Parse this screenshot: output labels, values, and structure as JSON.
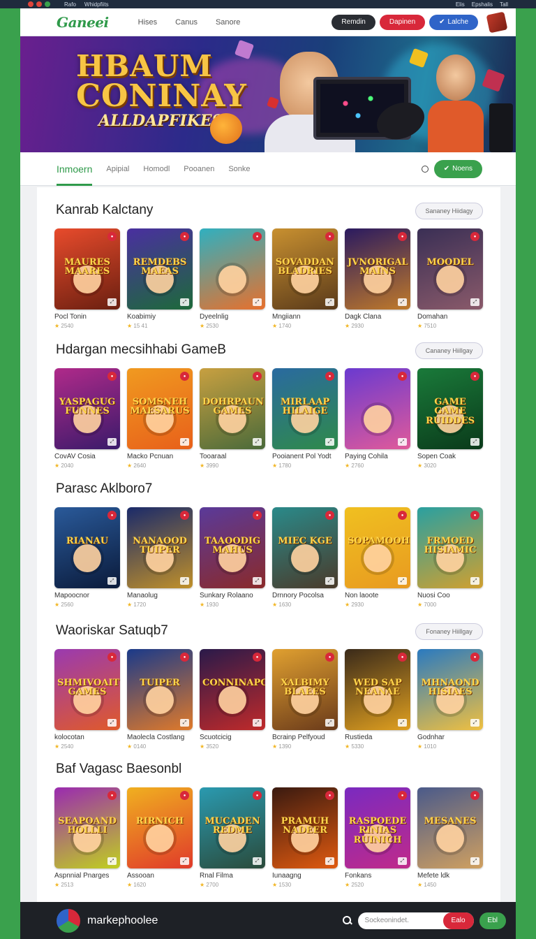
{
  "topbar": {
    "left": "Rafo",
    "left2": "Whidpfiits",
    "right": [
      "Elis",
      "Epshalis",
      "Tall"
    ]
  },
  "nav": {
    "logo": "Ganeei",
    "links": [
      "Hises",
      "Canus",
      "Sanore"
    ],
    "pills": [
      "Remdin",
      "Dapinen",
      "Lalche"
    ]
  },
  "hero": {
    "title_line1": "HBAUM",
    "title_line2": "CONINAY",
    "subtitle": "ALLDAPFIKES"
  },
  "tabs": {
    "items": [
      "Inmoern",
      "Apipial",
      "Homodl",
      "Pooanen",
      "Sonke"
    ],
    "active_index": 0,
    "action": "Noens"
  },
  "sections": [
    {
      "title": "Kanrab Kalctany",
      "button": "Sananey Hiidagy",
      "games": [
        {
          "name": "Pocl Tonin",
          "rating": "2540",
          "art": "MAURES MAARES",
          "colors": [
            "#e84b2c",
            "#6a1f10"
          ]
        },
        {
          "name": "Koabimiy",
          "rating": "15 41",
          "art": "REMDEBS MAEAS",
          "colors": [
            "#4a2fa0",
            "#1d6a3a"
          ]
        },
        {
          "name": "Dyeelnlig",
          "rating": "2530",
          "art": "",
          "colors": [
            "#2fb0c0",
            "#e8702c"
          ]
        },
        {
          "name": "Mngiiann",
          "rating": "1740",
          "art": "SOVADDAN BLADRIES",
          "colors": [
            "#c89030",
            "#5a3a1a"
          ]
        },
        {
          "name": "Dagk Clana",
          "rating": "2930",
          "art": "JVNORIGAL MAINS",
          "colors": [
            "#2a1a60",
            "#c07a2a"
          ]
        },
        {
          "name": "Domahan",
          "rating": "7510",
          "art": "MOODEL",
          "colors": [
            "#3a2f55",
            "#8a5a6a"
          ]
        }
      ]
    },
    {
      "title": "Hdargan mecsihhabi GameB",
      "button": "Cananey Hiillgay",
      "games": [
        {
          "name": "CovAV Cosia",
          "rating": "2040",
          "art": "YASPAGUG FUNNES",
          "colors": [
            "#b02a8a",
            "#3a1a6a"
          ]
        },
        {
          "name": "Macko Pcnuan",
          "rating": "2640",
          "art": "SOMSNEH MAESARUS",
          "colors": [
            "#f09a20",
            "#e8601a"
          ]
        },
        {
          "name": "Tooaraal",
          "rating": "3990",
          "art": "DOHRPAUN GAMES",
          "colors": [
            "#c8a040",
            "#4a6a3a"
          ]
        },
        {
          "name": "Pooianent Pol Yodt",
          "rating": "1780",
          "art": "MIRLAAP HILAIGE",
          "colors": [
            "#2a6aa0",
            "#2f8a4a"
          ]
        },
        {
          "name": "Paying Cohila",
          "rating": "2760",
          "art": "",
          "colors": [
            "#6a3ad0",
            "#e05a9a"
          ]
        },
        {
          "name": "Sopen Coak",
          "rating": "3020",
          "art": "GAME GAME RUIDDES",
          "colors": [
            "#1a7a3a",
            "#0a3a1a"
          ]
        }
      ]
    },
    {
      "title": "Parasc Aklboro7",
      "button": "",
      "games": [
        {
          "name": "Mapoocnor",
          "rating": "2560",
          "art": "RIANAU",
          "colors": [
            "#2a5a9a",
            "#0a1a3a"
          ]
        },
        {
          "name": "Manaolug",
          "rating": "1720",
          "art": "NANAOOD TUIPER",
          "colors": [
            "#1a2a6a",
            "#c0902a"
          ]
        },
        {
          "name": "Sunkary Rolaano",
          "rating": "1930",
          "art": "TAAOODIG MAHUS",
          "colors": [
            "#5a3a9a",
            "#8a2a2a"
          ]
        },
        {
          "name": "Drnnory Pocolsa",
          "rating": "1630",
          "art": "MIEC KGE",
          "colors": [
            "#2a8a8a",
            "#4a3a2a"
          ]
        },
        {
          "name": "Non laoote",
          "rating": "2930",
          "art": "SOPAMOOHEL",
          "colors": [
            "#f0c020",
            "#e89a20"
          ]
        },
        {
          "name": "Nuosi Coo",
          "rating": "7000",
          "art": "FRMOED HISIAMIC",
          "colors": [
            "#2aa0a0",
            "#d0a030"
          ]
        }
      ]
    },
    {
      "title": "Waoriskar Satuqb7",
      "button": "Fonaney Hiillgay",
      "games": [
        {
          "name": "kolocotan",
          "rating": "2540",
          "art": "SHMIVOAIT GAMES",
          "colors": [
            "#9a3ab0",
            "#e05a2a"
          ]
        },
        {
          "name": "Maolecla Costlang",
          "rating": "0140",
          "art": "TUIPER",
          "colors": [
            "#1a3a8a",
            "#e07a2a"
          ]
        },
        {
          "name": "Scuotcicig",
          "rating": "3520",
          "art": "CONNINAPODE",
          "colors": [
            "#2a1a4a",
            "#c02a2a"
          ]
        },
        {
          "name": "Bcrainp Pelfyoud",
          "rating": "1390",
          "art": "XALBIMY BLAEES",
          "colors": [
            "#e0a030",
            "#6a3a1a"
          ]
        },
        {
          "name": "Rustieda",
          "rating": "5330",
          "art": "WED SAP NEANAE",
          "colors": [
            "#3a2a1a",
            "#e0a020"
          ]
        },
        {
          "name": "Godnhar",
          "rating": "1010",
          "art": "MHNAOND HISIAES",
          "colors": [
            "#2a7ac0",
            "#f0c040"
          ]
        }
      ]
    },
    {
      "title": "Baf Vagasc Baesonbl",
      "button": "",
      "games": [
        {
          "name": "Aspnnial Pnarges",
          "rating": "2513",
          "art": "SEAPOAND HOLLLI",
          "colors": [
            "#9a2ab0",
            "#c0d020"
          ]
        },
        {
          "name": "Assooan",
          "rating": "1620",
          "art": "RIRNICH",
          "colors": [
            "#f0b020",
            "#e03a2a"
          ]
        },
        {
          "name": "Rnal Filma",
          "rating": "2700",
          "art": "MUCADEN REDME",
          "colors": [
            "#2a9ab0",
            "#2a4a3a"
          ]
        },
        {
          "name": "Iunaagng",
          "rating": "1530",
          "art": "PRAMUH NADEER",
          "colors": [
            "#3a1a10",
            "#e05a10"
          ]
        },
        {
          "name": "Fonkans",
          "rating": "2520",
          "art": "RASPOEDE RINIAS RUINICH",
          "colors": [
            "#7a2ac0",
            "#c02a8a"
          ]
        },
        {
          "name": "Mefete ldk",
          "rating": "1450",
          "art": "MESANES",
          "colors": [
            "#4a5a8a",
            "#d0a060"
          ]
        }
      ]
    }
  ],
  "footer": {
    "brand": "markephoolee",
    "search_placeholder": "Sockeonindet.",
    "search_button": "Ealo",
    "action": "Ebl"
  },
  "colors": {
    "accent": "#3aa14d",
    "red": "#d8283a",
    "blue": "#2f64c8",
    "dark": "#1e2126"
  }
}
